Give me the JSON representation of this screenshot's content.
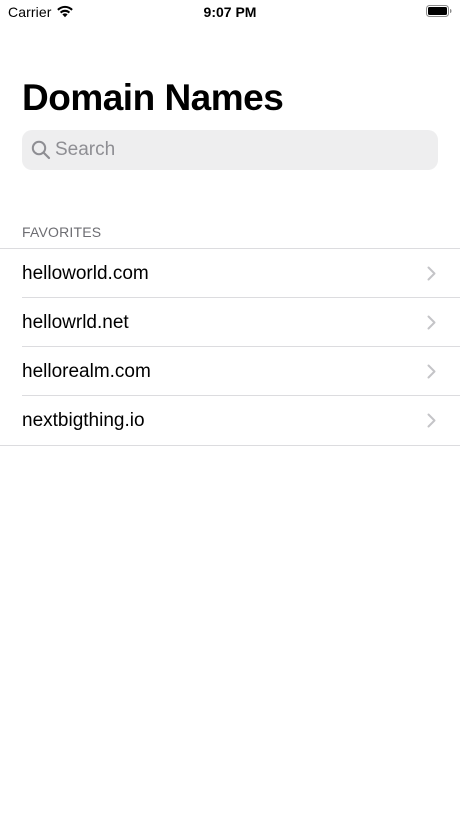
{
  "status_bar": {
    "carrier": "Carrier",
    "time": "9:07 PM"
  },
  "title": "Domain Names",
  "search": {
    "placeholder": "Search",
    "value": ""
  },
  "section": {
    "header": "FAVORITES"
  },
  "items": [
    {
      "label": "helloworld.com"
    },
    {
      "label": "hellowrld.net"
    },
    {
      "label": "hellorealm.com"
    },
    {
      "label": "nextbigthing.io"
    }
  ],
  "colors": {
    "search_background": "#eeeeef",
    "separator": "#dcdcdf",
    "secondary_text": "#6d6d72",
    "placeholder": "#8e8e93",
    "chevron": "#c4c4c7"
  }
}
